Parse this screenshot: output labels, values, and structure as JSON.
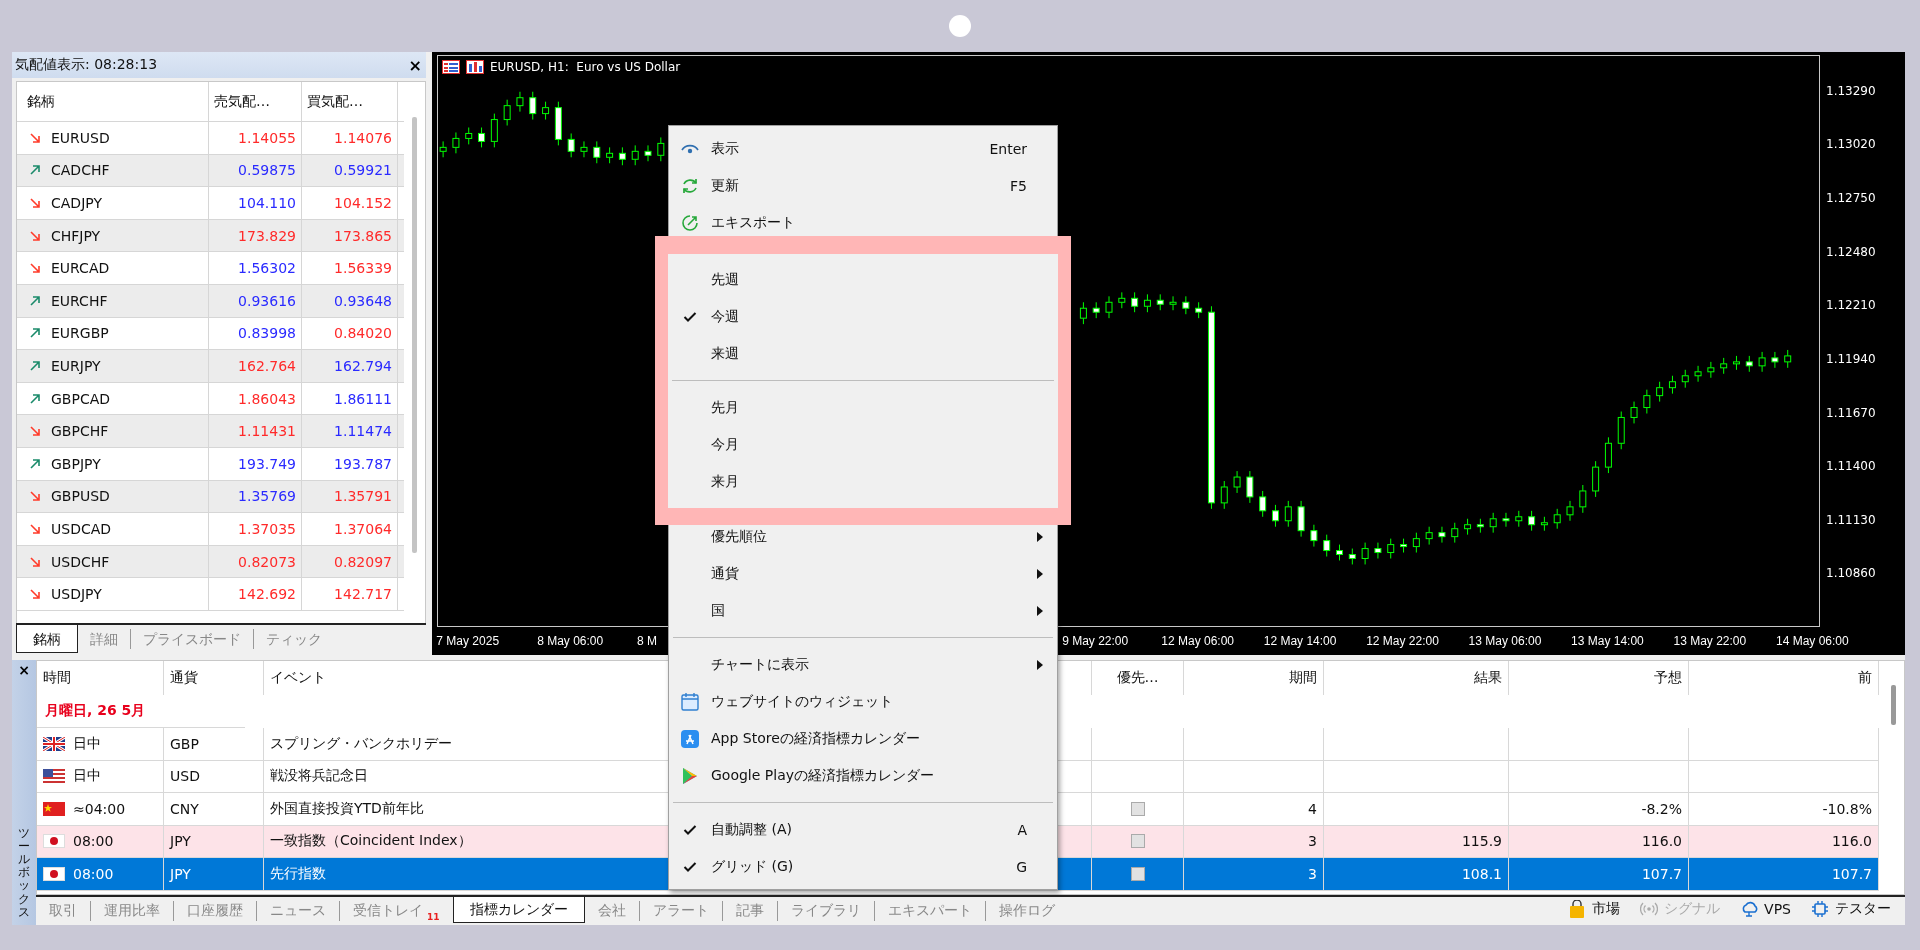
{
  "market_watch": {
    "title": "気配値表示: 08:28:13",
    "close": "×",
    "columns": [
      "銘柄",
      "売気配…",
      "買気配…"
    ],
    "rows": [
      {
        "symbol": "EURUSD",
        "rising": false,
        "bid": {
          "value": "1.14055",
          "color": "#ff2a2a"
        },
        "ask": {
          "value": "1.14076",
          "color": "#ff2a2a"
        }
      },
      {
        "symbol": "CADCHF",
        "rising": true,
        "bid": {
          "value": "0.59875",
          "color": "#2a2aff"
        },
        "ask": {
          "value": "0.59921",
          "color": "#2a2aff"
        }
      },
      {
        "symbol": "CADJPY",
        "rising": false,
        "bid": {
          "value": "104.110",
          "color": "#2a2aff"
        },
        "ask": {
          "value": "104.152",
          "color": "#ff2a2a"
        }
      },
      {
        "symbol": "CHFJPY",
        "rising": false,
        "bid": {
          "value": "173.829",
          "color": "#ff2a2a"
        },
        "ask": {
          "value": "173.865",
          "color": "#ff2a2a"
        }
      },
      {
        "symbol": "EURCAD",
        "rising": false,
        "bid": {
          "value": "1.56302",
          "color": "#2a2aff"
        },
        "ask": {
          "value": "1.56339",
          "color": "#ff2a2a"
        }
      },
      {
        "symbol": "EURCHF",
        "rising": true,
        "bid": {
          "value": "0.93616",
          "color": "#2a2aff"
        },
        "ask": {
          "value": "0.93648",
          "color": "#2a2aff"
        }
      },
      {
        "symbol": "EURGBP",
        "rising": true,
        "bid": {
          "value": "0.83998",
          "color": "#2a2aff"
        },
        "ask": {
          "value": "0.84020",
          "color": "#ff2a2a"
        }
      },
      {
        "symbol": "EURJPY",
        "rising": true,
        "bid": {
          "value": "162.764",
          "color": "#ff2a2a"
        },
        "ask": {
          "value": "162.794",
          "color": "#2a2aff"
        }
      },
      {
        "symbol": "GBPCAD",
        "rising": true,
        "bid": {
          "value": "1.86043",
          "color": "#ff2a2a"
        },
        "ask": {
          "value": "1.86111",
          "color": "#2a2aff"
        }
      },
      {
        "symbol": "GBPCHF",
        "rising": false,
        "bid": {
          "value": "1.11431",
          "color": "#ff2a2a"
        },
        "ask": {
          "value": "1.11474",
          "color": "#2a2aff"
        }
      },
      {
        "symbol": "GBPJPY",
        "rising": true,
        "bid": {
          "value": "193.749",
          "color": "#2a2aff"
        },
        "ask": {
          "value": "193.787",
          "color": "#2a2aff"
        }
      },
      {
        "symbol": "GBPUSD",
        "rising": false,
        "bid": {
          "value": "1.35769",
          "color": "#2a2aff"
        },
        "ask": {
          "value": "1.35791",
          "color": "#ff2a2a"
        }
      },
      {
        "symbol": "USDCAD",
        "rising": false,
        "bid": {
          "value": "1.37035",
          "color": "#ff2a2a"
        },
        "ask": {
          "value": "1.37064",
          "color": "#ff2a2a"
        }
      },
      {
        "symbol": "USDCHF",
        "rising": false,
        "bid": {
          "value": "0.82073",
          "color": "#ff2a2a"
        },
        "ask": {
          "value": "0.82097",
          "color": "#ff2a2a"
        }
      },
      {
        "symbol": "USDJPY",
        "rising": false,
        "bid": {
          "value": "142.692",
          "color": "#ff2a2a"
        },
        "ask": {
          "value": "142.717",
          "color": "#ff2a2a"
        }
      }
    ],
    "tabs": [
      {
        "label": "銘柄",
        "selected": true
      },
      {
        "label": "詳細",
        "selected": false
      },
      {
        "label": "プライスボード",
        "selected": false
      },
      {
        "label": "ティック",
        "selected": false
      }
    ]
  },
  "chart": {
    "chart_data": {
      "type": "candlestick",
      "title": "EURUSD, H1:  Euro vs US Dollar",
      "categories": [
        null,
        null,
        "7 May 2025",
        null,
        null,
        null,
        null,
        null,
        null,
        null,
        "8 May 06:00",
        null,
        null,
        null,
        null,
        null,
        "8 M",
        null,
        null,
        null,
        null,
        null,
        null,
        null,
        null,
        null,
        null,
        null,
        null,
        null,
        null,
        null,
        null,
        null,
        null,
        null,
        null,
        null,
        null,
        null,
        null,
        null,
        null,
        null,
        null,
        null,
        null,
        null,
        null,
        null,
        null,
        "9 May 22:00",
        null,
        null,
        null,
        null,
        null,
        null,
        null,
        "12 May 06:00",
        null,
        null,
        null,
        null,
        null,
        null,
        null,
        "12 May 14:00",
        null,
        null,
        null,
        null,
        null,
        null,
        null,
        "12 May 22:00",
        null,
        null,
        null,
        null,
        null,
        null,
        null,
        "13 May 06:00",
        null,
        null,
        null,
        null,
        null,
        null,
        null,
        "13 May 14:00",
        null,
        null,
        null,
        null,
        null,
        null,
        null,
        "13 May 22:00",
        null,
        null,
        null,
        null,
        null,
        null,
        null,
        "14 May 06:00"
      ],
      "ohlc": [
        [
          1.1299,
          1.1304,
          1.1296,
          1.1301
        ],
        [
          1.1301,
          1.13085,
          1.1298,
          1.13055
        ],
        [
          1.13055,
          1.1311,
          1.13025,
          1.1308
        ],
        [
          1.1308,
          1.1311,
          1.1301,
          1.1304
        ],
        [
          1.1304,
          1.1318,
          1.1301,
          1.1315
        ],
        [
          1.1315,
          1.1325,
          1.1312,
          1.1322
        ],
        [
          1.1322,
          1.1329,
          1.1319,
          1.1326
        ],
        [
          1.1326,
          1.1329,
          1.1315,
          1.1318
        ],
        [
          1.1318,
          1.1324,
          1.1315,
          1.1321
        ],
        [
          1.1321,
          1.1324,
          1.1302,
          1.1305
        ],
        [
          1.1305,
          1.1308,
          1.1296,
          1.1299
        ],
        [
          1.1299,
          1.1304,
          1.1296,
          1.1301
        ],
        [
          1.1301,
          1.1304,
          1.1293,
          1.1296
        ],
        [
          1.1296,
          1.1301,
          1.1293,
          1.1298
        ],
        [
          1.1298,
          1.1301,
          1.1292,
          1.1295
        ],
        [
          1.1295,
          1.1302,
          1.1292,
          1.1299
        ],
        [
          1.1299,
          1.1302,
          1.1294,
          1.1297
        ],
        [
          1.1297,
          1.1306,
          1.1294,
          1.1303
        ],
        null,
        null,
        null,
        null,
        null,
        null,
        null,
        null,
        null,
        null,
        null,
        null,
        null,
        null,
        null,
        null,
        null,
        null,
        null,
        null,
        null,
        null,
        null,
        null,
        null,
        null,
        null,
        null,
        null,
        null,
        null,
        null,
        [
          1.1215,
          1.1223,
          1.1212,
          1.122
        ],
        [
          1.122,
          1.1223,
          1.1215,
          1.1218
        ],
        [
          1.1218,
          1.1226,
          1.1215,
          1.1223
        ],
        [
          1.1223,
          1.1228,
          1.122,
          1.1225
        ],
        [
          1.1225,
          1.1228,
          1.1218,
          1.1221
        ],
        [
          1.1221,
          1.1227,
          1.1218,
          1.1224
        ],
        [
          1.1224,
          1.1227,
          1.1219,
          1.1222
        ],
        [
          1.1222,
          1.1226,
          1.1219,
          1.1223
        ],
        [
          1.1223,
          1.1226,
          1.1217,
          1.122
        ],
        [
          1.122,
          1.1223,
          1.1215,
          1.1218
        ],
        [
          1.1218,
          1.1221,
          1.1119,
          1.1122
        ],
        [
          1.1122,
          1.1133,
          1.1119,
          1.113
        ],
        [
          1.113,
          1.1138,
          1.1127,
          1.1135
        ],
        [
          1.1135,
          1.1138,
          1.1122,
          1.1125
        ],
        [
          1.1125,
          1.1128,
          1.1115,
          1.1118
        ],
        [
          1.1118,
          1.1121,
          1.111,
          1.1113
        ],
        [
          1.1113,
          1.1123,
          1.111,
          1.112
        ],
        [
          1.112,
          1.1123,
          1.1105,
          1.1108
        ],
        [
          1.1108,
          1.1111,
          1.11,
          1.1103
        ],
        [
          1.1103,
          1.1106,
          1.1095,
          1.1098
        ],
        [
          1.1098,
          1.1101,
          1.1093,
          1.1096
        ],
        [
          1.1096,
          1.1099,
          1.1091,
          1.1094
        ],
        [
          1.1094,
          1.1102,
          1.1091,
          1.1099
        ],
        [
          1.1099,
          1.1102,
          1.1094,
          1.1097
        ],
        [
          1.1097,
          1.1104,
          1.1094,
          1.1101
        ],
        [
          1.1101,
          1.1104,
          1.1097,
          1.11
        ],
        [
          1.11,
          1.1107,
          1.1097,
          1.1104
        ],
        [
          1.1104,
          1.111,
          1.1101,
          1.1107
        ],
        [
          1.1107,
          1.111,
          1.1102,
          1.1105
        ],
        [
          1.1105,
          1.1112,
          1.1102,
          1.1109
        ],
        [
          1.1109,
          1.1114,
          1.1106,
          1.1111
        ],
        [
          1.1111,
          1.1114,
          1.1107,
          1.111
        ],
        [
          1.111,
          1.1117,
          1.1107,
          1.1114
        ],
        [
          1.1114,
          1.1117,
          1.111,
          1.1113
        ],
        [
          1.1113,
          1.1118,
          1.111,
          1.1115
        ],
        [
          1.1115,
          1.1118,
          1.1108,
          1.1111
        ],
        [
          1.1111,
          1.1115,
          1.1108,
          1.1112
        ],
        [
          1.1112,
          1.1119,
          1.1109,
          1.1116
        ],
        [
          1.1116,
          1.1123,
          1.1113,
          1.112
        ],
        [
          1.112,
          1.1131,
          1.1117,
          1.1128
        ],
        [
          1.1128,
          1.1143,
          1.1125,
          1.114
        ],
        [
          1.114,
          1.1155,
          1.1137,
          1.1152
        ],
        [
          1.1152,
          1.1168,
          1.1149,
          1.1165
        ],
        [
          1.1165,
          1.1173,
          1.1162,
          1.117
        ],
        [
          1.117,
          1.1179,
          1.1167,
          1.1176
        ],
        [
          1.1176,
          1.1183,
          1.1173,
          1.118
        ],
        [
          1.118,
          1.1186,
          1.1177,
          1.1183
        ],
        [
          1.1183,
          1.1189,
          1.118,
          1.1186
        ],
        [
          1.1186,
          1.1191,
          1.1183,
          1.1188
        ],
        [
          1.1188,
          1.1193,
          1.1185,
          1.119
        ],
        [
          1.119,
          1.1195,
          1.1187,
          1.1192
        ],
        [
          1.1192,
          1.1196,
          1.1189,
          1.1193
        ],
        [
          1.1193,
          1.1196,
          1.1188,
          1.1191
        ],
        [
          1.1191,
          1.1198,
          1.1188,
          1.1195
        ],
        [
          1.1195,
          1.1198,
          1.119,
          1.1193
        ],
        [
          1.1193,
          1.1199,
          1.119,
          1.1196
        ],
        null,
        null
      ],
      "ylim": [
        1.1059,
        1.1347
      ],
      "yticks": [
        {
          "value": 1.1329,
          "label": "1.13290"
        },
        {
          "value": 1.1302,
          "label": "1.13020"
        },
        {
          "value": 1.1275,
          "label": "1.12750"
        },
        {
          "value": 1.1248,
          "label": "1.12480"
        },
        {
          "value": 1.1221,
          "label": "1.12210"
        },
        {
          "value": 1.1194,
          "label": "1.11940"
        },
        {
          "value": 1.1167,
          "label": "1.11670"
        },
        {
          "value": 1.114,
          "label": "1.11400"
        },
        {
          "value": 1.1113,
          "label": "1.11130"
        },
        {
          "value": 1.1086,
          "label": "1.10860"
        }
      ]
    }
  },
  "context_menu": {
    "items": [
      {
        "kind": "eye",
        "label": "表示",
        "shortcut": "Enter",
        "checked": false,
        "submenu": false
      },
      {
        "kind": "refresh",
        "label": "更新",
        "shortcut": "F5",
        "checked": false,
        "submenu": false
      },
      {
        "kind": "export",
        "label": "エキスポート",
        "checked": false,
        "submenu": false
      },
      {
        "kind": "highlight_box",
        "items": [
          {
            "kind": "plain",
            "label": "先週",
            "checked": false,
            "submenu": false
          },
          {
            "kind": "plain",
            "label": "今週",
            "checked": true,
            "submenu": false
          },
          {
            "kind": "plain",
            "label": "来週",
            "checked": false,
            "submenu": false
          },
          {
            "kind": "separator"
          },
          {
            "kind": "plain",
            "label": "先月",
            "checked": false,
            "submenu": false
          },
          {
            "kind": "plain",
            "label": "今月",
            "checked": false,
            "submenu": false
          },
          {
            "kind": "plain",
            "label": "来月",
            "checked": false,
            "submenu": false
          }
        ]
      },
      {
        "kind": "plain",
        "label": "優先順位",
        "checked": false,
        "submenu": true
      },
      {
        "kind": "plain",
        "label": "通貨",
        "checked": false,
        "submenu": true
      },
      {
        "kind": "plain",
        "label": "国",
        "checked": false,
        "submenu": true
      },
      {
        "kind": "separator"
      },
      {
        "kind": "plain",
        "label": "チャートに表示",
        "checked": false,
        "submenu": true
      },
      {
        "kind": "calendar",
        "label": "ウェブサイトのウィジェット",
        "checked": false,
        "submenu": false
      },
      {
        "kind": "store",
        "label": "App Storeの経済指標カレンダー",
        "checked": false,
        "submenu": false
      },
      {
        "kind": "play",
        "label": "Google Playの経済指標カレンダー",
        "checked": false,
        "submenu": false
      },
      {
        "kind": "separator"
      },
      {
        "kind": "plain",
        "label": "自動調整 (A)",
        "shortcut": "A",
        "checked": true,
        "submenu": false
      },
      {
        "kind": "plain",
        "label": "グリッド (G)",
        "shortcut": "G",
        "checked": true,
        "submenu": false
      }
    ]
  },
  "toolbox": {
    "title": "ツールボックス",
    "close": "×",
    "calendar": {
      "columns": [
        "時間",
        "通貨",
        "イベント",
        "優先…",
        "期間",
        "結果",
        "予想",
        "前"
      ],
      "date": "月曜日, 26 5月",
      "rows": [
        {
          "kind": "uk",
          "time": "日中",
          "currency": "GBP",
          "event": "スプリング・バンクホリデー",
          "highlighted": false,
          "selected": false
        },
        {
          "kind": "us",
          "time": "日中",
          "currency": "USD",
          "event": "戦没将兵記念日",
          "highlighted": false,
          "selected": false
        },
        {
          "kind": "china",
          "time": "≈04:00",
          "currency": "CNY",
          "event": "外国直接投資YTD前年比",
          "priority_checked": false,
          "period": "4",
          "forecast": "-8.2%",
          "previous": "-10.8%",
          "highlighted": false,
          "selected": false
        },
        {
          "kind": "japan",
          "time": "08:00",
          "currency": "JPY",
          "event": "一致指数（Coincident Index）",
          "priority_checked": false,
          "period": "3",
          "actual": "115.9",
          "forecast": "116.0",
          "previous": "116.0",
          "highlighted": true,
          "selected": false
        },
        {
          "kind": "japan",
          "time": "08:00",
          "currency": "JPY",
          "event": "先行指数",
          "priority_checked": false,
          "period": "3",
          "actual": "108.1",
          "forecast": "107.7",
          "previous": "107.7",
          "highlighted": false,
          "selected": true
        }
      ]
    },
    "tabs": [
      {
        "label": "取引",
        "selected": false
      },
      {
        "label": "運用比率",
        "selected": false
      },
      {
        "label": "口座履歴",
        "selected": false
      },
      {
        "label": "ニュース",
        "selected": false
      },
      {
        "label": "受信トレイ",
        "badge": "11",
        "selected": false
      },
      {
        "label": "指標カレンダー",
        "selected": true
      },
      {
        "label": "会社",
        "selected": false
      },
      {
        "label": "アラート",
        "selected": false
      },
      {
        "label": "記事",
        "selected": false
      },
      {
        "label": "ライブラリ",
        "selected": false
      },
      {
        "label": "エキスパート",
        "selected": false
      },
      {
        "label": "操作ログ",
        "selected": false
      }
    ],
    "status": [
      {
        "kind": "market",
        "label": "市場",
        "disabled": false
      },
      {
        "kind": "signal",
        "label": "シグナル",
        "disabled": true
      },
      {
        "kind": "vps",
        "label": "VPS",
        "disabled": false
      },
      {
        "kind": "tester",
        "label": "テスター",
        "disabled": false
      }
    ]
  }
}
